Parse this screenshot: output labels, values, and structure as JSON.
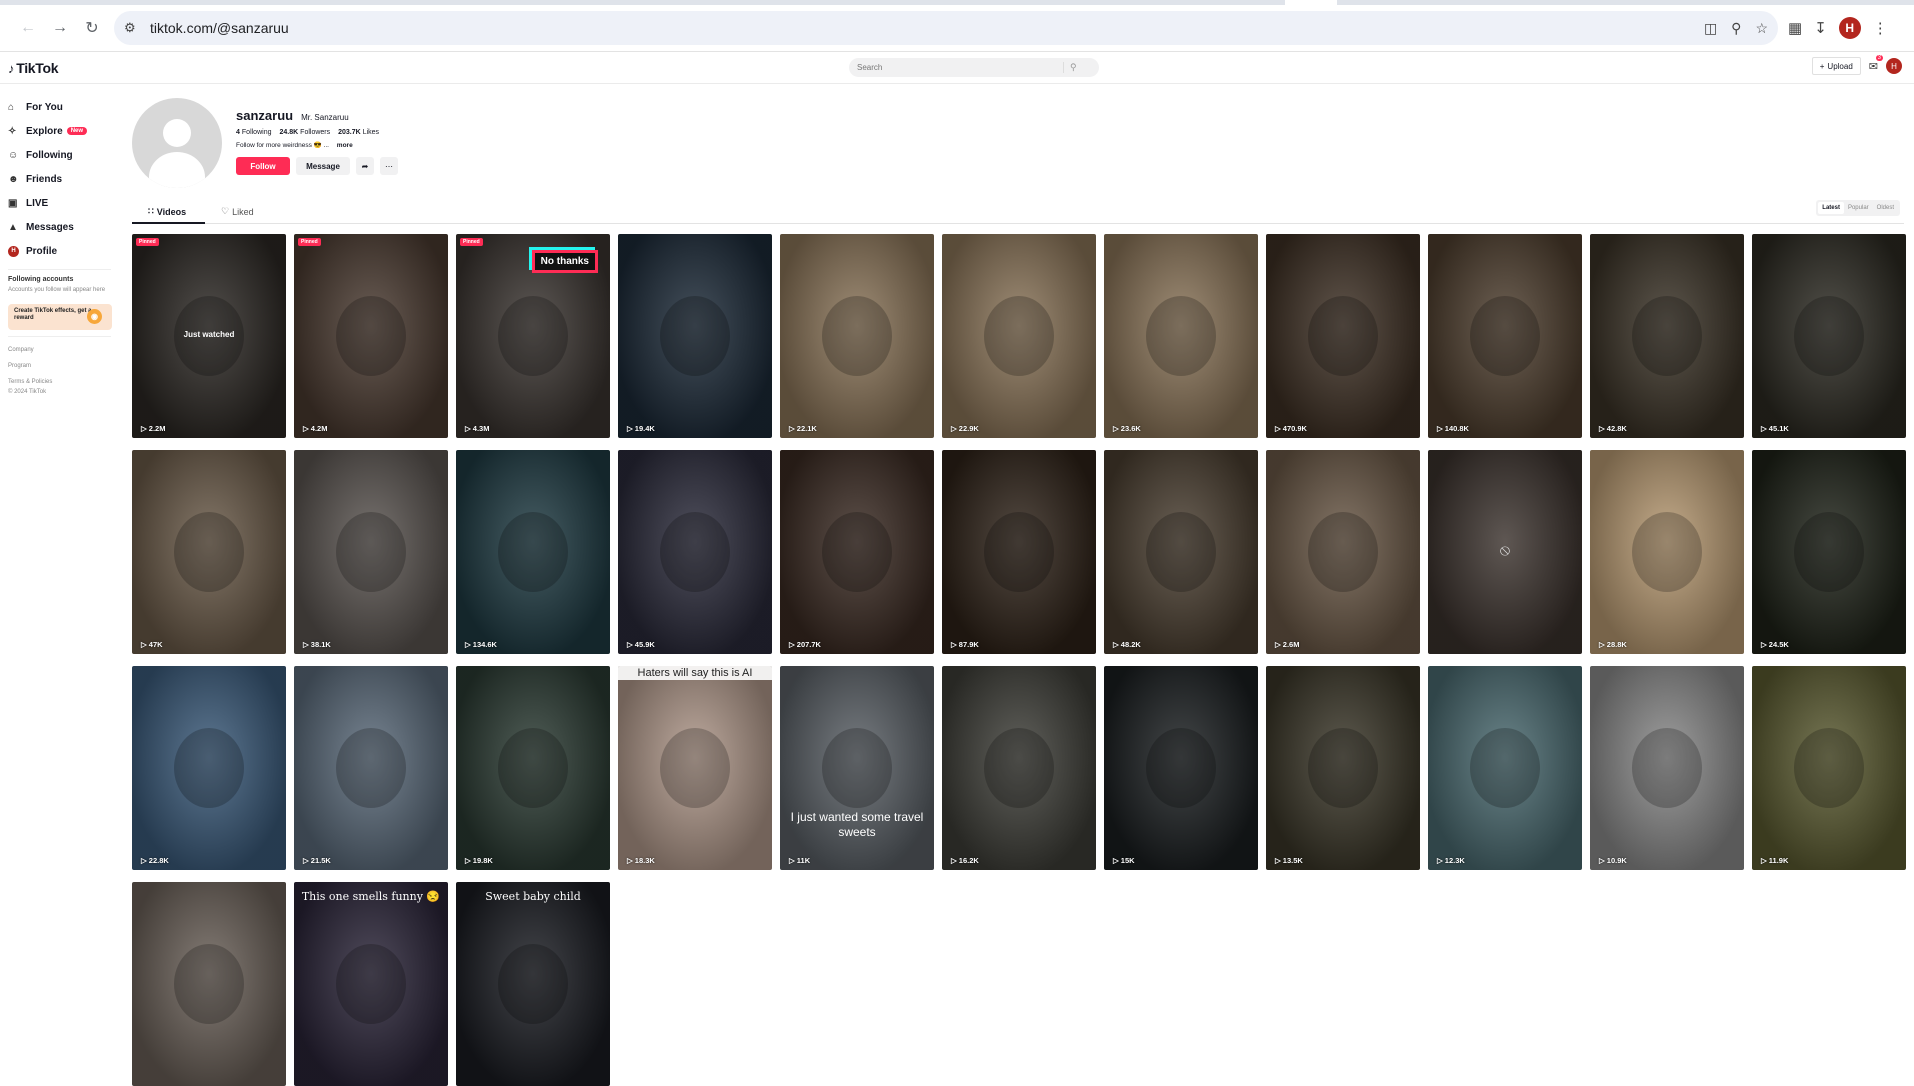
{
  "browser": {
    "url": "tiktok.com/@sanzaruu",
    "profile_initial": "H"
  },
  "header": {
    "logo": "TikTok",
    "search_placeholder": "Search",
    "upload_label": "Upload",
    "inbox_count": "3",
    "avatar_initial": "H"
  },
  "sidebar": {
    "items": [
      {
        "label": "For You",
        "icon": "home-icon"
      },
      {
        "label": "Explore",
        "icon": "compass-icon",
        "badge": "New"
      },
      {
        "label": "Following",
        "icon": "person-icon"
      },
      {
        "label": "Friends",
        "icon": "people-icon"
      },
      {
        "label": "LIVE",
        "icon": "live-icon"
      },
      {
        "label": "Messages",
        "icon": "paper-plane-icon"
      },
      {
        "label": "Profile",
        "icon": "avatar-icon",
        "avatar_initial": "H"
      }
    ],
    "following_title": "Following accounts",
    "following_desc": "Accounts you follow will appear here",
    "reward_text": "Create TikTok effects, get a reward",
    "links": [
      "Company",
      "Program",
      "Terms & Policies",
      "© 2024 TikTok"
    ]
  },
  "profile": {
    "username": "sanzaruu",
    "nickname": "Mr. Sanzaruu",
    "following_count": "4",
    "following_label": "Following",
    "followers_count": "24.8K",
    "followers_label": "Followers",
    "likes_count": "203.7K",
    "likes_label": "Likes",
    "bio": "Follow for more weirdness 😎 ...",
    "bio_more": "more",
    "follow_label": "Follow",
    "message_label": "Message"
  },
  "tabs": {
    "videos": "Videos",
    "liked": "Liked",
    "sort": [
      "Latest",
      "Popular",
      "Oldest"
    ]
  },
  "videos": [
    {
      "views": "2.2M",
      "pinned": "Pinned",
      "overlay": "Just watched",
      "bg": "#2c2824"
    },
    {
      "views": "4.2M",
      "pinned": "Pinned",
      "bg": "#4a3a30"
    },
    {
      "views": "4.3M",
      "pinned": "Pinned",
      "overlay_box": "No thanks",
      "bg": "#3a3430"
    },
    {
      "views": "19.4K",
      "bg": "#1c2a38"
    },
    {
      "views": "22.1K",
      "bg": "#8a7458"
    },
    {
      "views": "22.9K",
      "bg": "#8a7458"
    },
    {
      "views": "23.6K",
      "bg": "#8a7458"
    },
    {
      "views": "470.9K",
      "bg": "#3e3024"
    },
    {
      "views": "140.8K",
      "bg": "#4e3e2e"
    },
    {
      "views": "42.8K",
      "bg": "#3a3226"
    },
    {
      "views": "45.1K",
      "bg": "#2c2a22"
    },
    {
      "views": "47K",
      "bg": "#6a5a48"
    },
    {
      "views": "38.1K",
      "bg": "#5a5450"
    },
    {
      "views": "134.6K",
      "bg": "#1e3a42"
    },
    {
      "views": "45.9K",
      "bg": "#2a2a3a"
    },
    {
      "views": "207.7K",
      "bg": "#3a2a22"
    },
    {
      "views": "87.9K",
      "bg": "#2e2218"
    },
    {
      "views": "48.2K",
      "bg": "#4a3e30"
    },
    {
      "views": "2.6M",
      "bg": "#6a5846"
    },
    {
      "views": "",
      "hidden": true,
      "bg": "#3b322d"
    },
    {
      "views": "28.8K",
      "bg": "#b89a72"
    },
    {
      "views": "24.5K",
      "bg": "#1e2218"
    },
    {
      "views": "22.8K",
      "bg": "#3a5a7a"
    },
    {
      "views": "21.5K",
      "bg": "#5a6a7a"
    },
    {
      "views": "19.8K",
      "bg": "#2a3a32"
    },
    {
      "views": "18.3K",
      "caption_top": "Haters will say this is AI",
      "bg": "#b0988a"
    },
    {
      "views": "11K",
      "caption_mid": "I just wanted some travel sweets",
      "bg": "#5a6066"
    },
    {
      "views": "16.2K",
      "bg": "#3e3e38"
    },
    {
      "views": "15K",
      "bg": "#1a1e20"
    },
    {
      "views": "13.5K",
      "bg": "#3a3628"
    },
    {
      "views": "12.3K",
      "bg": "#4a6a70"
    },
    {
      "views": "10.9K",
      "bg": "#8a8a8a"
    },
    {
      "views": "11.9K",
      "bg": "#5a5a30"
    },
    {
      "views": "",
      "bg": "#6a6058"
    },
    {
      "views": "",
      "caption_serif": "This one smells funny 😒",
      "bg": "#2a2438"
    },
    {
      "views": "",
      "caption_serif": "Sweet baby child",
      "bg": "#1a1c22"
    }
  ]
}
